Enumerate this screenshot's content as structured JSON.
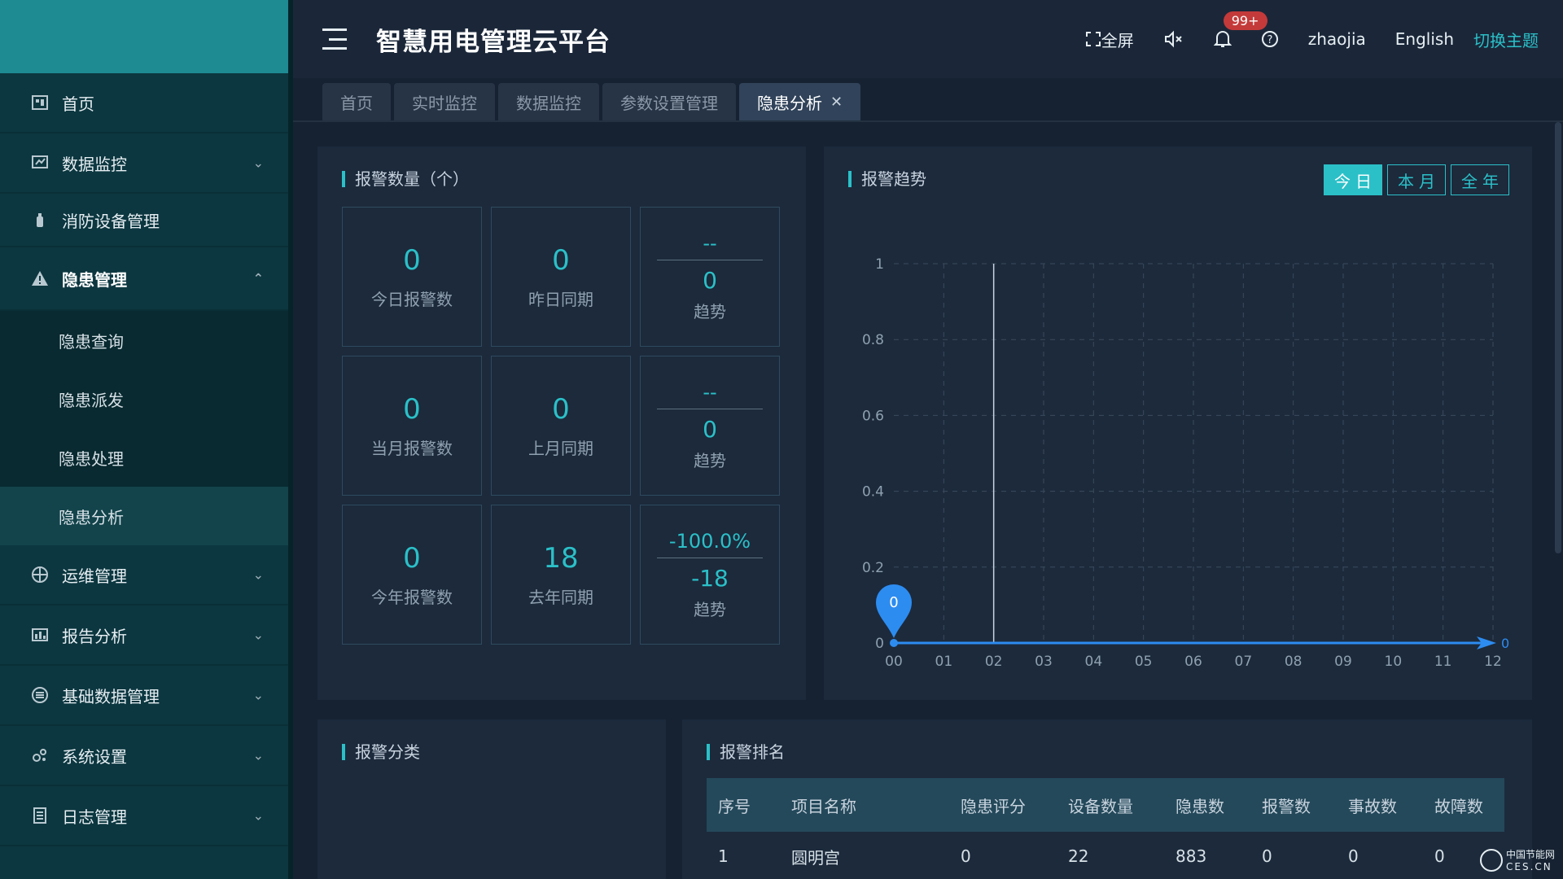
{
  "app": {
    "title": "智慧用电管理云平台"
  },
  "header": {
    "fullscreen_label": "全屏",
    "notification_count": "99+",
    "username": "zhaojia",
    "language": "English",
    "theme_label": "切换主题"
  },
  "sidebar": {
    "items": [
      {
        "label": "首页",
        "icon": "home-icon"
      },
      {
        "label": "数据监控",
        "icon": "monitor-icon"
      },
      {
        "label": "消防设备管理",
        "icon": "extinguisher-icon"
      },
      {
        "label": "隐患管理",
        "icon": "warning-icon"
      },
      {
        "label": "运维管理",
        "icon": "globe-icon"
      },
      {
        "label": "报告分析",
        "icon": "report-icon"
      },
      {
        "label": "基础数据管理",
        "icon": "database-icon"
      },
      {
        "label": "系统设置",
        "icon": "settings-icon"
      },
      {
        "label": "日志管理",
        "icon": "log-icon"
      }
    ],
    "submenu": [
      {
        "label": "隐患查询"
      },
      {
        "label": "隐患派发"
      },
      {
        "label": "隐患处理"
      },
      {
        "label": "隐患分析"
      }
    ]
  },
  "tabs": [
    {
      "label": "首页"
    },
    {
      "label": "实时监控"
    },
    {
      "label": "数据监控"
    },
    {
      "label": "参数设置管理"
    },
    {
      "label": "隐患分析"
    }
  ],
  "alarm_count": {
    "title": "报警数量（个）",
    "rows": [
      {
        "current": "0",
        "current_label": "今日报警数",
        "previous": "0",
        "previous_label": "昨日同期",
        "trend_pct": "--",
        "trend_val": "0",
        "trend_label": "趋势"
      },
      {
        "current": "0",
        "current_label": "当月报警数",
        "previous": "0",
        "previous_label": "上月同期",
        "trend_pct": "--",
        "trend_val": "0",
        "trend_label": "趋势"
      },
      {
        "current": "0",
        "current_label": "今年报警数",
        "previous": "18",
        "previous_label": "去年同期",
        "trend_pct": "-100.0%",
        "trend_val": "-18",
        "trend_label": "趋势"
      }
    ]
  },
  "alarm_trend": {
    "title": "报警趋势",
    "range_buttons": [
      "今日",
      "本月",
      "全年"
    ],
    "marker_value": "0",
    "end_label": "0"
  },
  "chart_data": {
    "type": "line",
    "title": "报警趋势",
    "x": [
      "00",
      "01",
      "02",
      "03",
      "04",
      "05",
      "06",
      "07",
      "08",
      "09",
      "10",
      "11",
      "12"
    ],
    "values": [
      0,
      0,
      0,
      0,
      0,
      0,
      0,
      0,
      0,
      0,
      0,
      0,
      0
    ],
    "yticks": [
      "0",
      "0.2",
      "0.4",
      "0.6",
      "0.8",
      "1"
    ],
    "ylim": [
      0,
      1
    ],
    "grid": true,
    "color": "#2d8cf0"
  },
  "alarm_category": {
    "title": "报警分类"
  },
  "alarm_ranking": {
    "title": "报警排名",
    "headers": [
      "序号",
      "项目名称",
      "隐患评分",
      "设备数量",
      "隐患数",
      "报警数",
      "事故数",
      "故障数"
    ],
    "rows": [
      [
        "1",
        "圆明宫",
        "0",
        "22",
        "883",
        "0",
        "0",
        "0"
      ]
    ]
  },
  "watermark": {
    "text": "中国节能网",
    "sub": "CES.CN"
  },
  "colors": {
    "accent": "#2bc0c8",
    "sidebar": "#0c3740",
    "background": "#162232"
  }
}
